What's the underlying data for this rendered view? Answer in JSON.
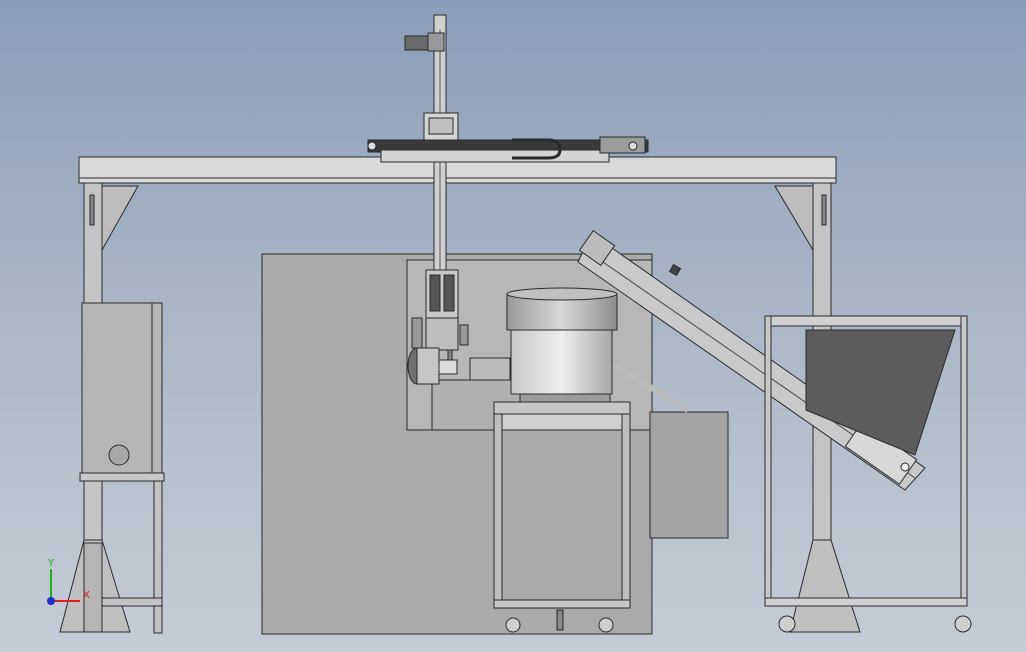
{
  "viewport": {
    "view_triad": {
      "x_label": "X",
      "y_label": "Y",
      "x_color": "#e02020",
      "y_color": "#20b020",
      "z_color": "#2030d0"
    }
  },
  "colors": {
    "background_top": "#8a9db8",
    "background_bottom": "#c6ccd6",
    "steel": "#b8b8b8",
    "machine_body": "#a9a9a9",
    "hopper_dark": "#5c5c5c",
    "outline": "#2a2a2a"
  }
}
